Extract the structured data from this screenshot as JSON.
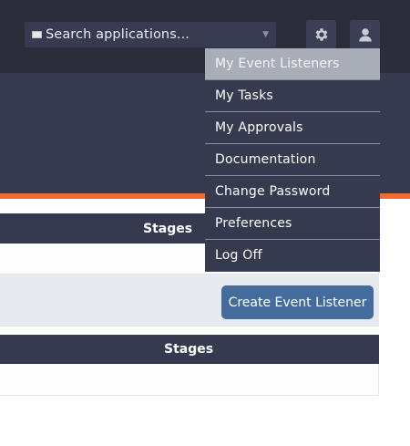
{
  "navbar": {
    "search_label": "Search applications...",
    "caret": "▼"
  },
  "icons": {
    "gear": "gear-icon",
    "user": "user-icon"
  },
  "user_menu": {
    "items": [
      {
        "label": "My Event Listeners",
        "active": true
      },
      {
        "label": "My Tasks"
      },
      {
        "label": "My Approvals"
      },
      {
        "label": "Documentation"
      },
      {
        "label": "Change Password"
      },
      {
        "label": "Preferences"
      },
      {
        "label": "Log Off"
      }
    ]
  },
  "tables": [
    {
      "header": "Stages"
    },
    {
      "header": "Stages"
    }
  ],
  "toolbar": {
    "create_label": "Create Event Listener"
  },
  "colors": {
    "navbar": "#2b2d3b",
    "band": "#363a4f",
    "accent_orange": "#f26b2f",
    "primary_button": "#446d9e",
    "active_menu": "#a9adb7"
  }
}
